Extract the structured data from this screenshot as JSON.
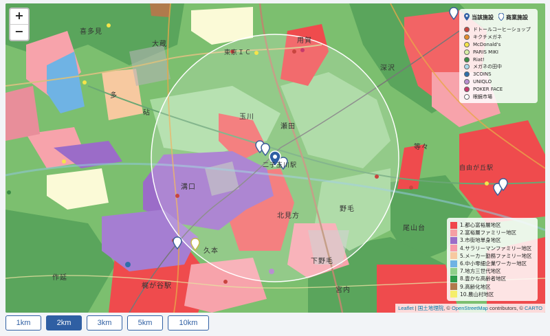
{
  "zoom": {
    "in_label": "+",
    "out_label": "−"
  },
  "facility_legend": {
    "own_label": "当該施設",
    "commercial_label": "商業施設",
    "items": [
      {
        "name": "ドトールコーヒーショップ",
        "color": "#c8453f"
      },
      {
        "name": "キクチメガネ",
        "color": "#e58d2c"
      },
      {
        "name": "McDonald's",
        "color": "#f5e44a"
      },
      {
        "name": "PARIS MIKI",
        "color": "#d9f0a6"
      },
      {
        "name": "Riat!",
        "color": "#3c8c46"
      },
      {
        "name": "メガネの田中",
        "color": "#a9d8ec"
      },
      {
        "name": "3COINS",
        "color": "#2f6faa"
      },
      {
        "name": "UNIQLO",
        "color": "#b88fd1"
      },
      {
        "name": "POKER FACE",
        "color": "#c83a6b"
      },
      {
        "name": "眼鏡市場",
        "color": "#ffffff"
      }
    ]
  },
  "area_legend": {
    "items": [
      {
        "label": "1.都心富裕層地区",
        "color": "#f0464a"
      },
      {
        "label": "2.富裕層ファミリー地区",
        "color": "#f5a0a4"
      },
      {
        "label": "3.市街地単身地区",
        "color": "#9b6cc8"
      },
      {
        "label": "4.サラリーマンファミリー地区",
        "color": "#f79aa8"
      },
      {
        "label": "5.メーカー勤務ファミリー地区",
        "color": "#f7c9a0"
      },
      {
        "label": "6.中小零細企業ワーカー地区",
        "color": "#6fb3e4"
      },
      {
        "label": "7.地方三世代地区",
        "color": "#8fd08a"
      },
      {
        "label": "8.豊かな高齢者地区",
        "color": "#2e9c4a"
      },
      {
        "label": "9.高齢化地区",
        "color": "#b07a4c"
      },
      {
        "label": "10.農山村地区",
        "color": "#f5ee6a"
      }
    ]
  },
  "map_labels": [
    {
      "text": "喜多見"
    },
    {
      "text": "大蔵"
    },
    {
      "text": "東京ＩＣ"
    },
    {
      "text": "用賀"
    },
    {
      "text": "深沢"
    },
    {
      "text": "玉川"
    },
    {
      "text": "瀬田"
    },
    {
      "text": "二子玉川駅"
    },
    {
      "text": "自由が丘駅"
    },
    {
      "text": "溝口"
    },
    {
      "text": "北見方"
    },
    {
      "text": "野毛"
    },
    {
      "text": "尾山台"
    },
    {
      "text": "久本"
    },
    {
      "text": "下野毛"
    },
    {
      "text": "宮内"
    },
    {
      "text": "作延"
    },
    {
      "text": "梶が谷駅"
    },
    {
      "text": "多"
    },
    {
      "text": "等々"
    },
    {
      "text": "砧"
    }
  ],
  "attribution": {
    "leaflet": "Leaflet",
    "gsi": "国土地理院",
    "osm": "OpenStreetMap",
    "carto": "CARTO",
    "sep": " | ",
    "c1": ", © ",
    "c2": " contributors, © "
  },
  "radius_buttons": [
    {
      "label": "1km",
      "active": false
    },
    {
      "label": "2km",
      "active": true
    },
    {
      "label": "3km",
      "active": false
    },
    {
      "label": "5km",
      "active": false
    },
    {
      "label": "10km",
      "active": false
    }
  ]
}
